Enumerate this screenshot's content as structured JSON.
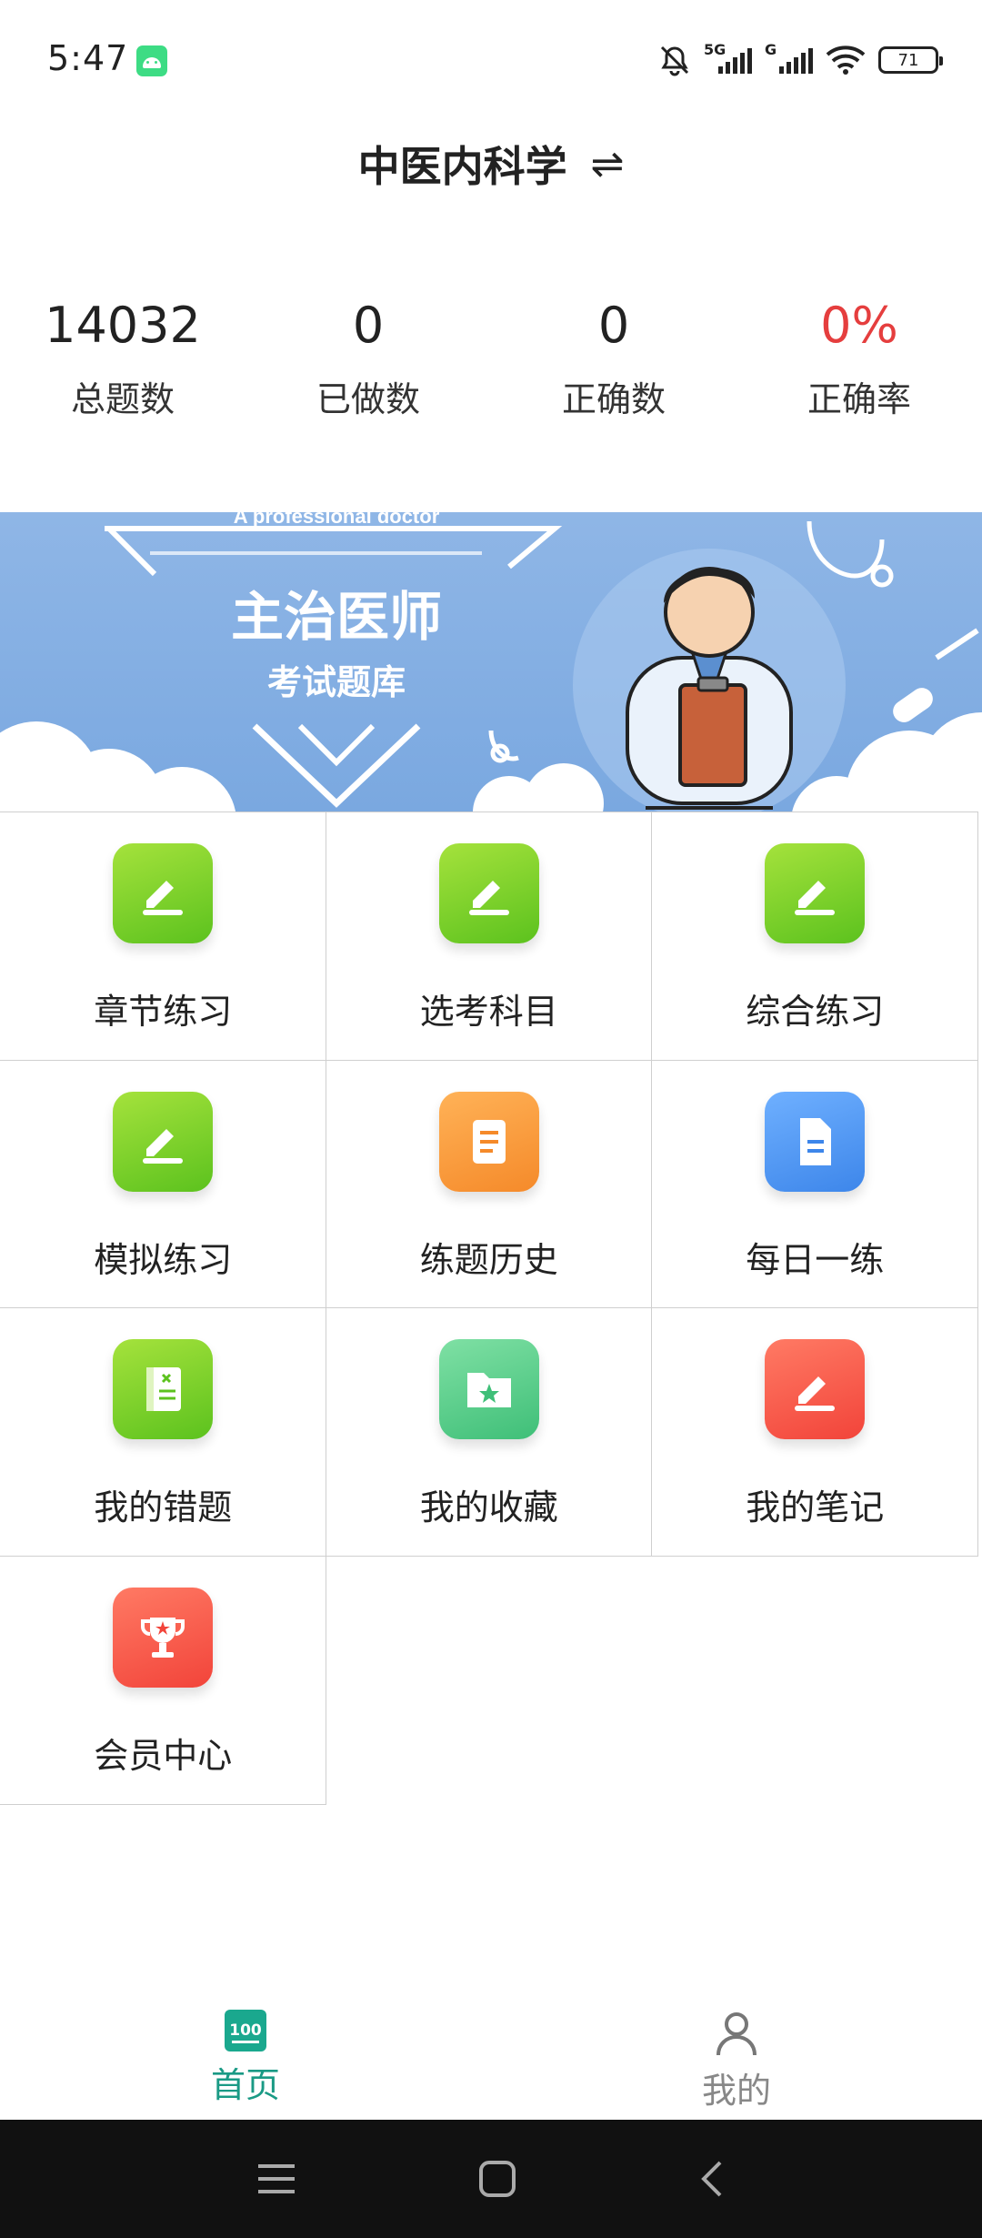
{
  "status_bar": {
    "time": "5:47",
    "signal1_label": "5G",
    "signal2_label": "G",
    "battery": "71"
  },
  "header": {
    "title": "中医内科学",
    "swap_icon": "⇌"
  },
  "stats": [
    {
      "value": "14032",
      "label": "总题数"
    },
    {
      "value": "0",
      "label": "已做数"
    },
    {
      "value": "0",
      "label": "正确数"
    },
    {
      "value": "0%",
      "label": "正确率"
    }
  ],
  "banner": {
    "subtitle_en": "A professional doctor",
    "title": "主治医师",
    "subtitle": "考试题库"
  },
  "grid": [
    {
      "label": "章节练习",
      "icon": "pencil-note-icon",
      "color": "#6fcf2a"
    },
    {
      "label": "选考科目",
      "icon": "pencil-note-icon",
      "color": "#6fcf2a"
    },
    {
      "label": "综合练习",
      "icon": "pencil-note-icon",
      "color": "#6fcf2a"
    },
    {
      "label": "模拟练习",
      "icon": "pencil-note-icon",
      "color": "#6fcf2a"
    },
    {
      "label": "练题历史",
      "icon": "scroll-icon",
      "color": "#f89a3a"
    },
    {
      "label": "每日一练",
      "icon": "document-icon",
      "color": "#4a93f0"
    },
    {
      "label": "我的错题",
      "icon": "wrong-book-icon",
      "color": "#6fcf2a"
    },
    {
      "label": "我的收藏",
      "icon": "star-folder-icon",
      "color": "#4ccb84"
    },
    {
      "label": "我的笔记",
      "icon": "pencil-note-icon",
      "color": "#f2503f"
    },
    {
      "label": "会员中心",
      "icon": "trophy-icon",
      "color": "#f2503f"
    }
  ],
  "tabbar": {
    "home": {
      "label": "首页",
      "icon_text": "100"
    },
    "mine": {
      "label": "我的"
    }
  },
  "colors": {
    "accent": "#1a9a85",
    "rate_red": "#e53e3e"
  }
}
